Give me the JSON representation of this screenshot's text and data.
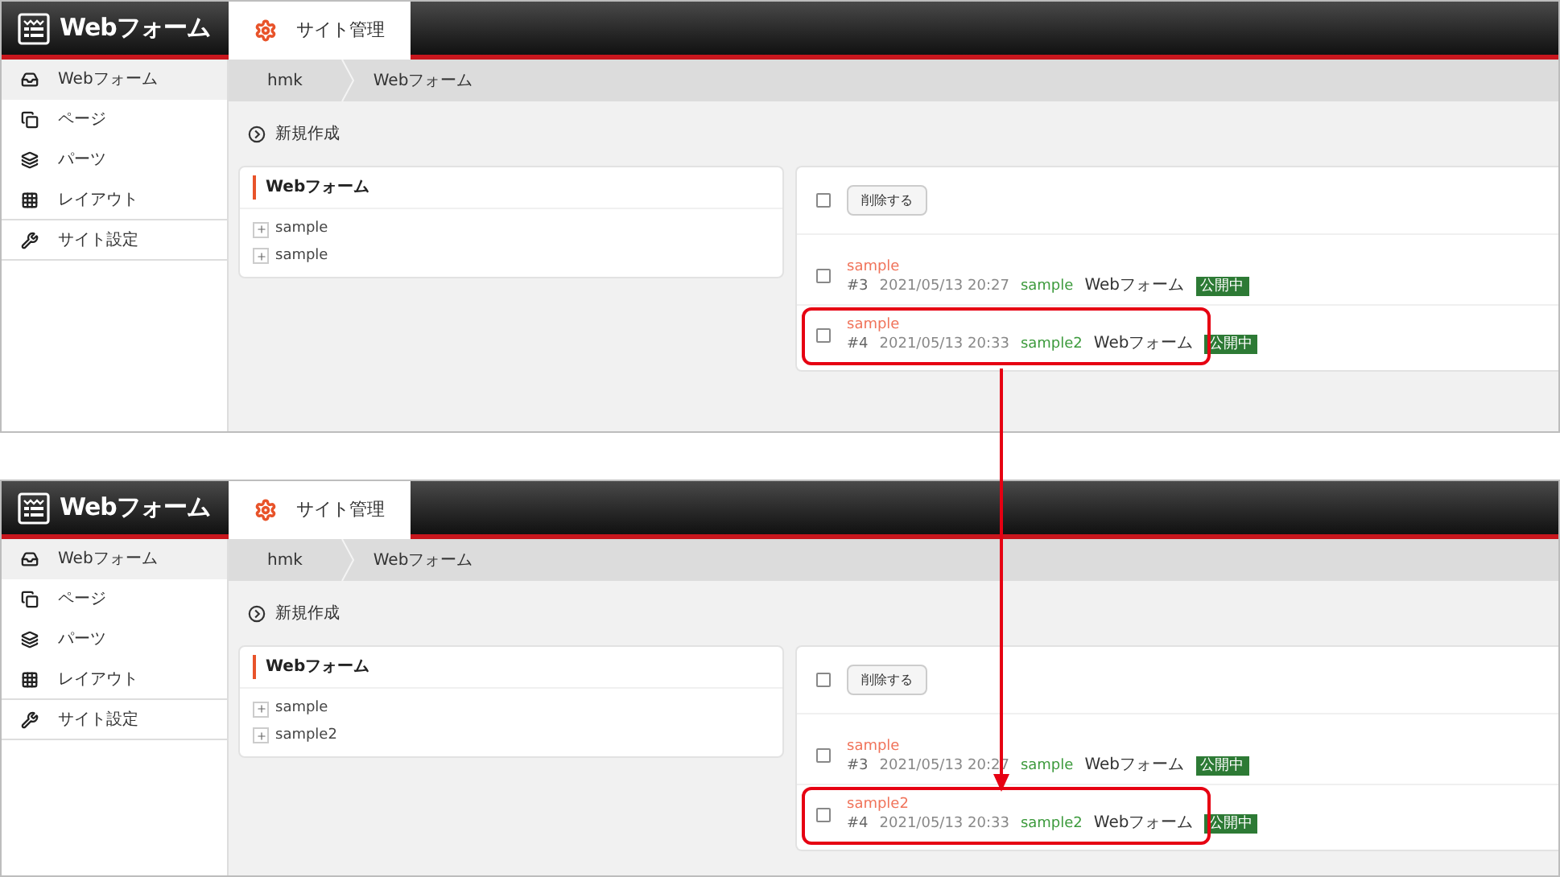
{
  "screens": [
    {
      "logo": "Webフォーム",
      "tab": "サイト管理",
      "sidebar": [
        {
          "label": "Webフォーム",
          "selected": true
        },
        {
          "label": "ページ",
          "selected": false
        },
        {
          "label": "パーツ",
          "selected": false
        },
        {
          "label": "レイアウト",
          "selected": false
        },
        {
          "label": "サイト設定",
          "selected": false
        }
      ],
      "breadcrumb": [
        "hmk",
        "Webフォーム"
      ],
      "new_link": "新規作成",
      "tree": {
        "title": "Webフォーム",
        "items": [
          "sample",
          "sample"
        ]
      },
      "list": {
        "select_all_checked": false,
        "delete_button": "削除する",
        "rows": [
          {
            "checked": false,
            "title": "sample",
            "id": "#3",
            "date": "2021/05/13 20:27",
            "author": "sample",
            "type": "Webフォーム",
            "status": "公開中",
            "highlighted": false
          },
          {
            "checked": false,
            "title": "sample",
            "id": "#4",
            "date": "2021/05/13 20:33",
            "author": "sample2",
            "type": "Webフォーム",
            "status": "公開中",
            "highlighted": true
          }
        ]
      }
    },
    {
      "logo": "Webフォーム",
      "tab": "サイト管理",
      "sidebar": [
        {
          "label": "Webフォーム",
          "selected": true
        },
        {
          "label": "ページ",
          "selected": false
        },
        {
          "label": "パーツ",
          "selected": false
        },
        {
          "label": "レイアウト",
          "selected": false
        },
        {
          "label": "サイト設定",
          "selected": false
        }
      ],
      "breadcrumb": [
        "hmk",
        "Webフォーム"
      ],
      "new_link": "新規作成",
      "tree": {
        "title": "Webフォーム",
        "items": [
          "sample",
          "sample2"
        ]
      },
      "list": {
        "select_all_checked": false,
        "delete_button": "削除する",
        "rows": [
          {
            "checked": false,
            "title": "sample",
            "id": "#3",
            "date": "2021/05/13 20:27",
            "author": "sample",
            "type": "Webフォーム",
            "status": "公開中",
            "highlighted": false
          },
          {
            "checked": false,
            "title": "sample2",
            "id": "#4",
            "date": "2021/05/13 20:33",
            "author": "sample2",
            "type": "Webフォーム",
            "status": "公開中",
            "highlighted": true
          }
        ]
      }
    }
  ]
}
